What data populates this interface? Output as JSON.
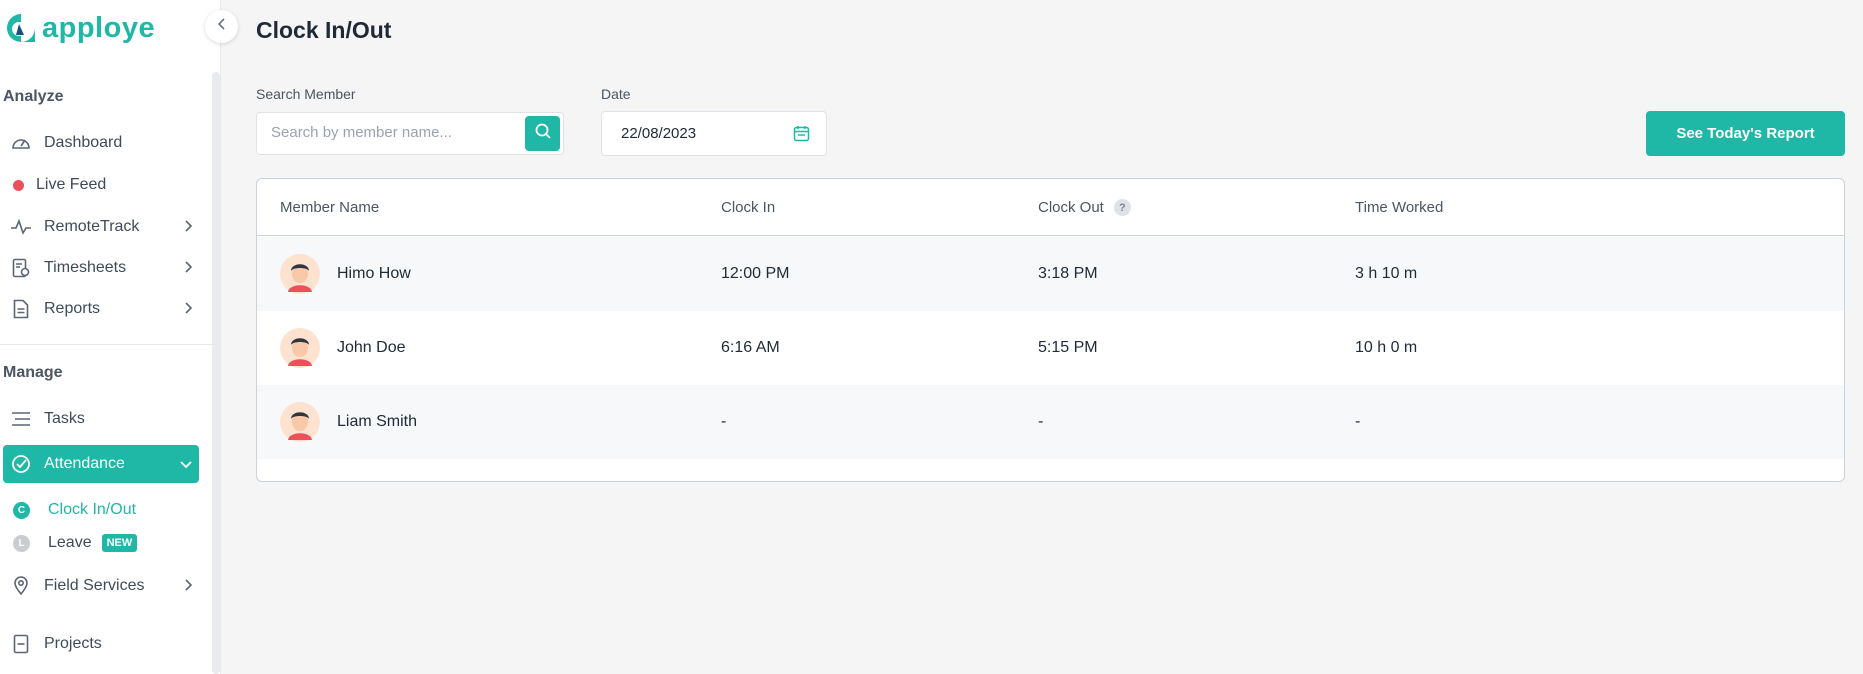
{
  "app": {
    "brand": "apploye"
  },
  "sidebar": {
    "sections": {
      "analyze": "Analyze",
      "manage": "Manage"
    },
    "items": {
      "dashboard": "Dashboard",
      "live_feed": "Live Feed",
      "remotetrack": "RemoteTrack",
      "timesheets": "Timesheets",
      "reports": "Reports",
      "tasks": "Tasks",
      "attendance": "Attendance",
      "clock_inout": "Clock In/Out",
      "leave": "Leave",
      "field_services": "Field Services",
      "projects": "Projects"
    },
    "sub_letters": {
      "clock": "C",
      "leave": "L"
    },
    "new_badge": "NEW"
  },
  "page": {
    "title": "Clock In/Out",
    "search_label": "Search Member",
    "search_placeholder": "Search by member name...",
    "date_label": "Date",
    "date_value": "22/08/2023",
    "report_button": "See Today's Report"
  },
  "table": {
    "headers": {
      "member": "Member Name",
      "clock_in": "Clock In",
      "clock_out": "Clock Out",
      "time_worked": "Time Worked",
      "help": "?"
    },
    "rows": [
      {
        "name": "Himo How",
        "clock_in": "12:00 PM",
        "clock_out": "3:18 PM",
        "time_worked": "3 h 10 m"
      },
      {
        "name": "John Doe",
        "clock_in": "6:16 AM",
        "clock_out": "5:15 PM",
        "time_worked": "10 h 0 m"
      },
      {
        "name": "Liam Smith",
        "clock_in": "-",
        "clock_out": "-",
        "time_worked": "-"
      }
    ]
  },
  "colors": {
    "accent": "#1fb8a6",
    "live": "#ef4f5a"
  }
}
